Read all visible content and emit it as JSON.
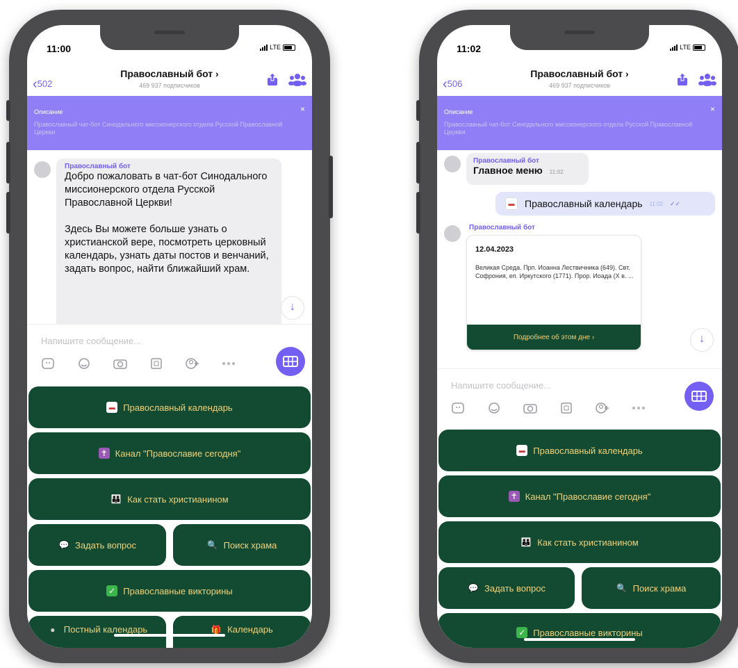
{
  "accent_color": "#7360f2",
  "button_color": "#134a32",
  "button_text_color": "#f0d37a",
  "left": {
    "status": {
      "time": "11:00",
      "network": "LTE"
    },
    "nav": {
      "back": "502",
      "title": "Православный бот ›",
      "subtitle": "469 937 подписчиков"
    },
    "description": {
      "label": "Описание",
      "text": "Православный чат-бот Синодального миссионерского отдела Русской Православной Церкви",
      "close": "×"
    },
    "message": {
      "sender": "Православный бот",
      "text1": "Добро пожаловать в чат-бот Синодального миссионерского отдела Русской Православной Церкви!",
      "text2": "Здесь Вы можете больше узнать о христианской вере, посмотреть церковный календарь, узнать даты постов и венчаний, задать вопрос, найти ближайший храм."
    },
    "composer": {
      "placeholder": "Напишите сообщение..."
    },
    "keyboard": {
      "b1": "Православный календарь",
      "b2": "Канал \"Православие сегодня\"",
      "b3": "Как стать христианином",
      "b4": "Задать вопрос",
      "b5": "Поиск храма",
      "b6": "Православные викторины",
      "b7": "Постный календарь",
      "b8": "Календарь"
    }
  },
  "right": {
    "status": {
      "time": "11:02",
      "network": "LTE"
    },
    "nav": {
      "back": "506",
      "title": "Православный бот ›",
      "subtitle": "469 937 подписчиков"
    },
    "description": {
      "label": "Описание",
      "text": "Православный чат-бот Синодального миссионерского отдела Русской Православной Церкви",
      "close": "×"
    },
    "msg1": {
      "sender": "Православный бот",
      "text": "Главное меню",
      "time": "11:02"
    },
    "outgoing": {
      "text": "Православный календарь",
      "time": "11:02"
    },
    "msg2": {
      "sender": "Православный бот",
      "date": "12.04.2023",
      "text": "Великая Среда. Прп. Иоанна Лествичника (649). Свт. Софрония, еп. Иркутского (1771). Прор. Иоада (X в. ...",
      "button": "Подробнее об этом дне ›"
    },
    "composer": {
      "placeholder": "Напишите сообщение..."
    },
    "keyboard": {
      "b1": "Православный календарь",
      "b2": "Канал \"Православие сегодня\"",
      "b3": "Как стать христианином",
      "b4": "Задать вопрос",
      "b5": "Поиск храма",
      "b6": "Православные викторины"
    }
  }
}
